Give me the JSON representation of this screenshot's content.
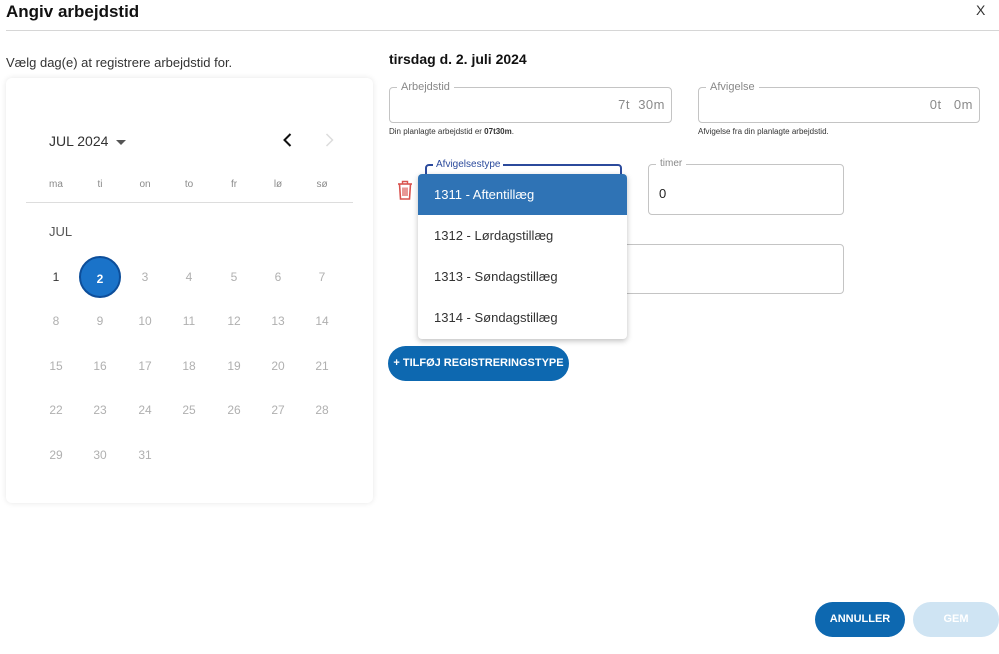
{
  "dialog": {
    "title": "Angiv arbejdstid",
    "close_label": "X"
  },
  "instruction": "Vælg dag(e) at registrere arbejdstid for.",
  "calendar": {
    "month_label": "JUL 2024",
    "month_short": "JUL",
    "weekdays": [
      "ma",
      "ti",
      "on",
      "to",
      "fr",
      "lø",
      "sø"
    ],
    "days": [
      "1",
      "2",
      "3",
      "4",
      "5",
      "6",
      "7",
      "8",
      "9",
      "10",
      "11",
      "12",
      "13",
      "14",
      "15",
      "16",
      "17",
      "18",
      "19",
      "20",
      "21",
      "22",
      "23",
      "24",
      "25",
      "26",
      "27",
      "28",
      "29",
      "30",
      "31"
    ],
    "selected_day": "2"
  },
  "selected_date": "tirsdag d. 2. juli 2024",
  "arbejdstid": {
    "label": "Arbejdstid",
    "value": "7t  30m",
    "helper_prefix": "Din planlagte arbejdstid er ",
    "helper_bold": "07t30m",
    "helper_suffix": "."
  },
  "afvigelse": {
    "label": "Afvigelse",
    "value": "0t   0m",
    "helper": "Afvigelse fra din planlagte arbejdstid."
  },
  "registration": {
    "type_label": "Afvigelsestype",
    "hours_label": "timer",
    "hours_value": "0",
    "options": [
      "1311 - Aftentillæg",
      "1312 - Lørdagstillæg",
      "1313 - Søndagstillæg",
      "1314 - Søndagstillæg"
    ]
  },
  "buttons": {
    "add_type": "+ TILFØJ REGISTRERINGSTYPE",
    "cancel": "ANNULLER",
    "save": "GEM"
  },
  "colors": {
    "primary": "#0d68b0",
    "selected_day": "#1a73c9",
    "dropdown_active": "#2f73b5",
    "save_disabled": "#cfe4f3",
    "trash": "#d9534f",
    "focus_outline": "#2b4a9c"
  }
}
